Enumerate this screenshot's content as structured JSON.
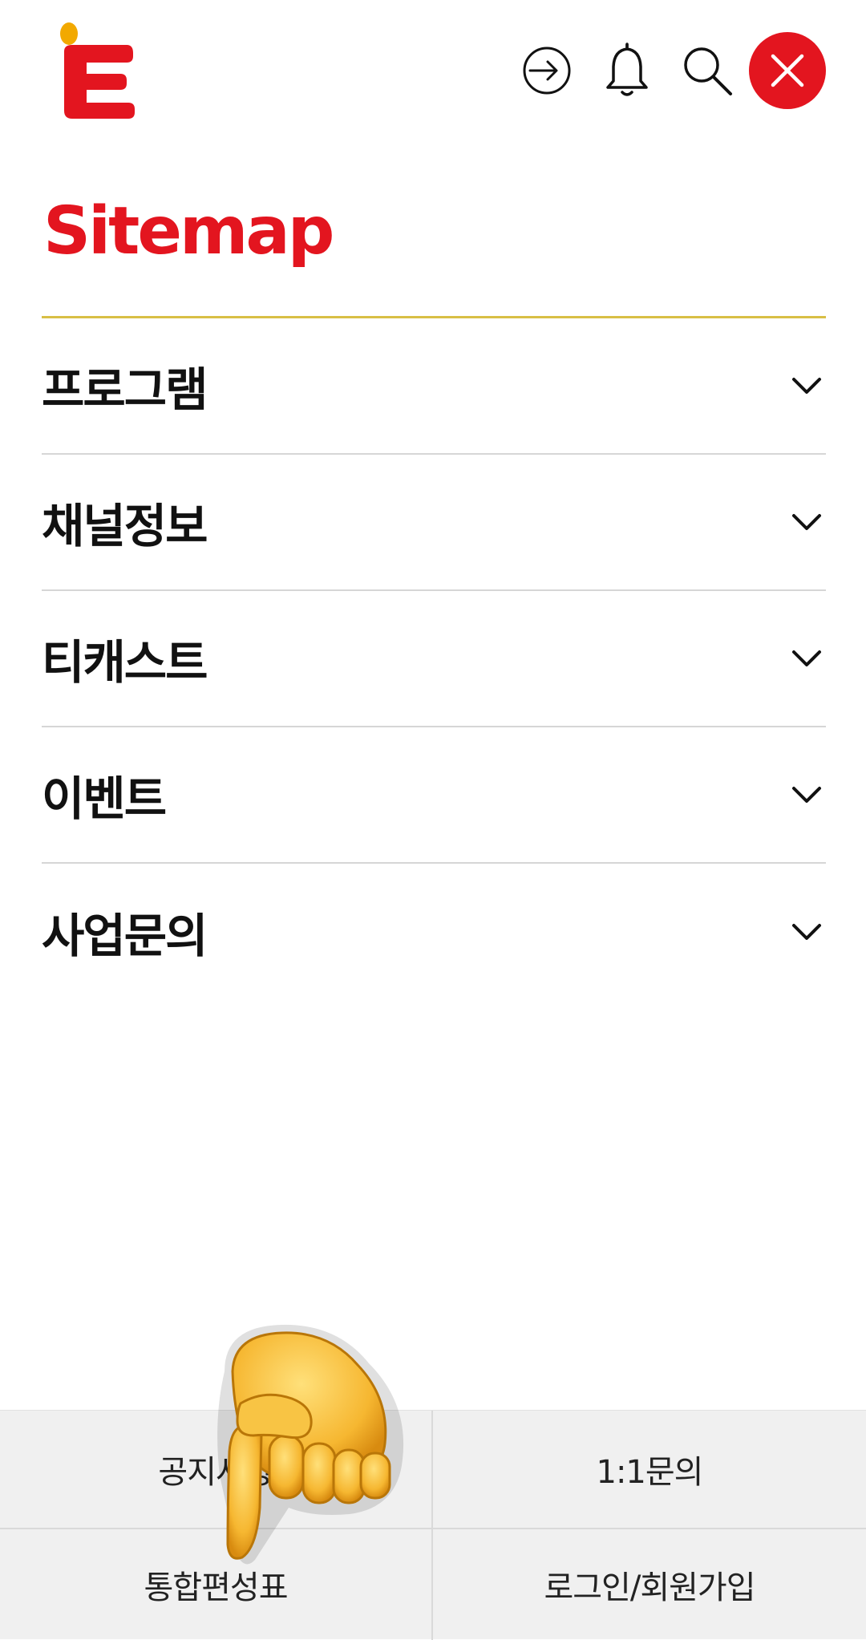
{
  "app": {
    "logo_letter": "E",
    "brand_color": "#e3151f",
    "accent_dot_color": "#f2a900"
  },
  "header": {
    "icons": [
      "login-icon",
      "bell-icon",
      "search-icon",
      "close-icon"
    ]
  },
  "sitemap": {
    "title": "Sitemap",
    "rule_color": "#d8bf45",
    "items": [
      {
        "label": "프로그램"
      },
      {
        "label": "채널정보"
      },
      {
        "label": "티캐스트"
      },
      {
        "label": "이벤트"
      },
      {
        "label": "사업문의"
      }
    ]
  },
  "footer": {
    "links": [
      {
        "label": "공지사항"
      },
      {
        "label": "1:1문의"
      },
      {
        "label": "통합편성표"
      },
      {
        "label": "로그인/회원가입"
      }
    ]
  },
  "overlay": {
    "emoji": "pointing-down-hand-icon"
  }
}
